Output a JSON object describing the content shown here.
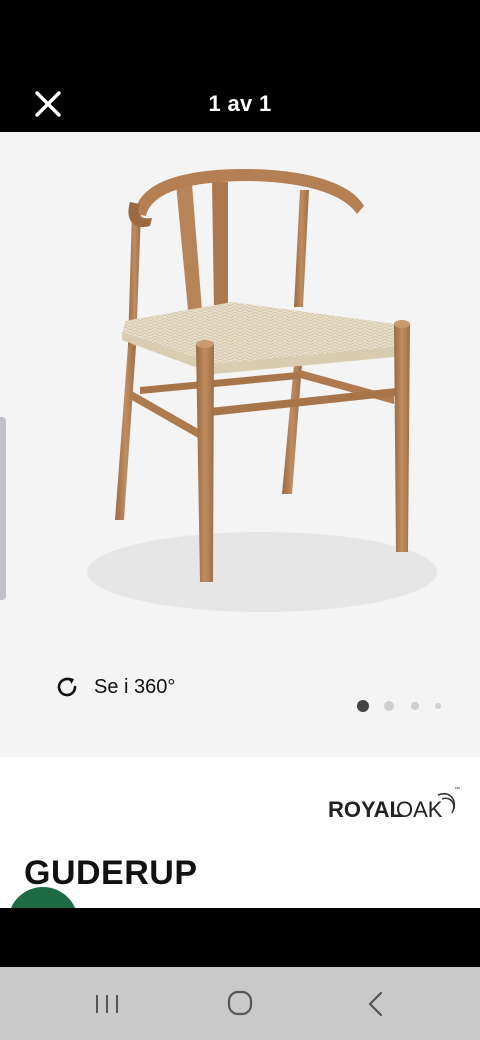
{
  "header": {
    "title": "1 av 1",
    "close_icon": "close-icon"
  },
  "gallery": {
    "view360_label": "Se i 360°",
    "view360_icon": "rotate-icon",
    "page_dots": {
      "count": 4,
      "active_index": 0
    }
  },
  "product": {
    "brand": "ROYAL OAK",
    "brand_part1": "ROYAL",
    "brand_part2": "OAK",
    "brand_tm": "™",
    "name": "GUDERUP"
  },
  "system_nav": {
    "recents_icon": "recents-icon",
    "home_icon": "home-icon",
    "back_icon": "back-icon"
  },
  "colors": {
    "wood": "#b07a4f",
    "seat": "#e6dcc6",
    "fab": "#1d6b45"
  }
}
